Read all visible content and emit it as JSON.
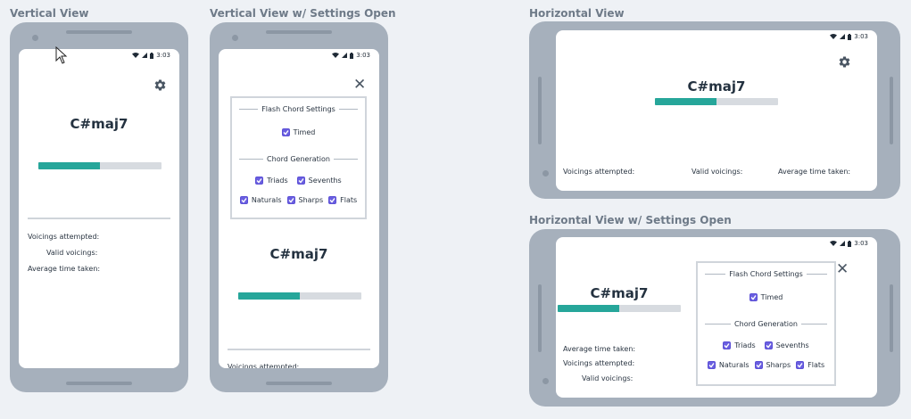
{
  "labels": {
    "vertical": "Vertical View",
    "vertical_settings": "Vertical View w/ Settings Open",
    "horizontal": "Horizontal View",
    "horizontal_settings": "Horizontal View w/ Settings Open"
  },
  "status": {
    "time": "3:03"
  },
  "chord": {
    "name": "C#maj7",
    "progress": 0.5
  },
  "stats": {
    "voicings_attempted": "Voicings attempted:",
    "valid_voicings": "Valid voicings:",
    "average_time": "Average time taken:"
  },
  "settings": {
    "flash_title": "Flash Chord Settings",
    "timed": "Timed",
    "generation_title": "Chord Generation",
    "triads": "Triads",
    "sevenths": "Sevenths",
    "naturals": "Naturals",
    "sharps": "Sharps",
    "flats": "Flats"
  },
  "icons": {
    "settings": "gear-icon",
    "close": "close-icon",
    "check": "checkbox-checked-icon"
  },
  "colors": {
    "progress_fill": "#26a69a",
    "checkbox": "#6a5fe0"
  }
}
